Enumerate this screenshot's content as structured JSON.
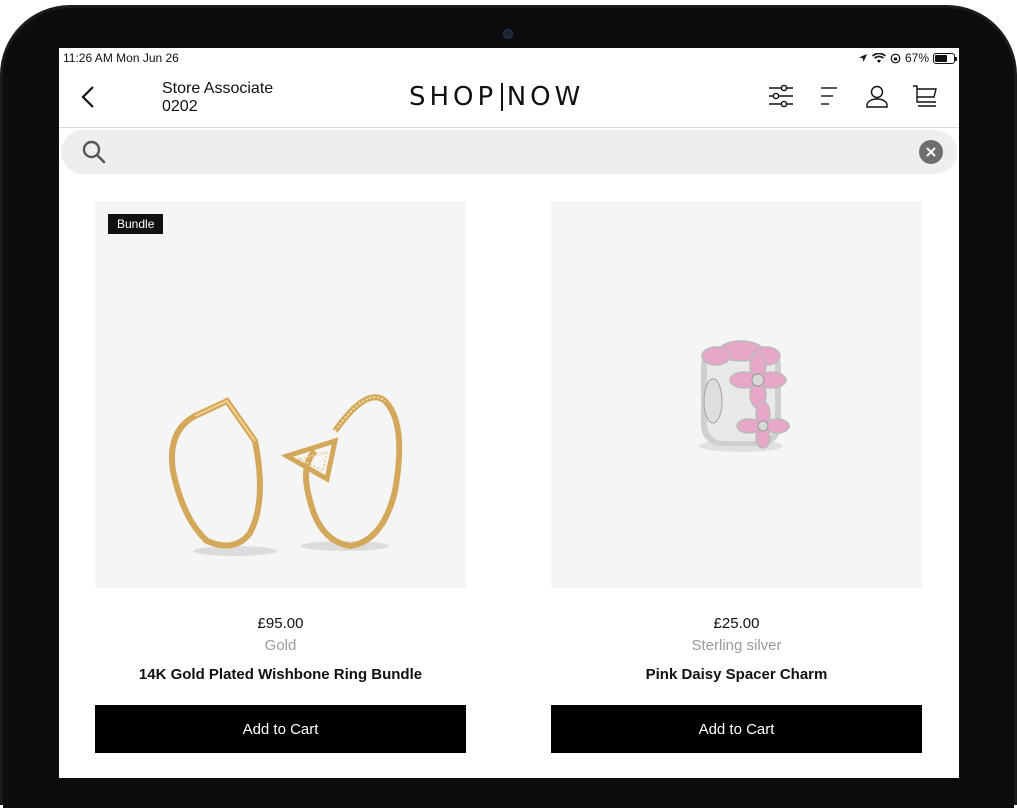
{
  "status_bar": {
    "time_date": "11:26 AM  Mon Jun 26",
    "battery": "67%"
  },
  "header": {
    "store_line1": "Store Associate",
    "store_line2": "0202",
    "logo_left": "SHOP",
    "logo_right": "NOW",
    "icons": [
      "filter-icon",
      "menu-icon",
      "account-icon",
      "cart-icon"
    ]
  },
  "search": {
    "value": "",
    "placeholder": ""
  },
  "products": [
    {
      "badge": "Bundle",
      "price": "£95.00",
      "material": "Gold",
      "name": "14K Gold Plated Wishbone Ring Bundle",
      "button": "Add to Cart"
    },
    {
      "badge": "",
      "price": "£25.00",
      "material": "Sterling silver",
      "name": "Pink Daisy Spacer Charm",
      "button": "Add to Cart"
    }
  ],
  "colors": {
    "accent": "#000000",
    "gold": "#d9b36a",
    "pink": "#e8a6c8"
  }
}
